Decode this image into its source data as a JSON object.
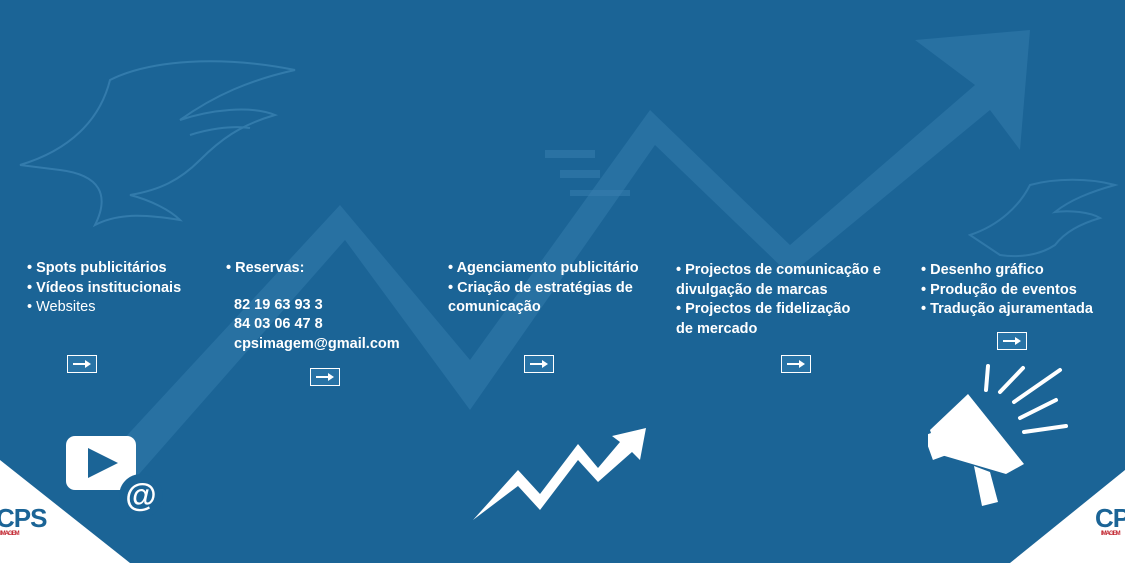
{
  "columns": [
    {
      "items": [
        "• Spots publicitários",
        "• Vídeos institucionais",
        "• Websites"
      ]
    },
    {
      "heading": "• Reservas:",
      "phone1": "82 19 63 93 3",
      "phone2": "84 03 06 47 8",
      "email": "cpsimagem@gmail.com"
    },
    {
      "items": [
        "• Agenciamento publicitário",
        "• Criação de estratégias de",
        "comunicação"
      ]
    },
    {
      "items": [
        "• Projectos de comunicação e",
        "divulgação de marcas",
        "• Projectos de fidelização",
        "de mercado"
      ]
    },
    {
      "items": [
        "• Desenho gráfico",
        "• Produção de eventos",
        "• Tradução ajuramentada"
      ]
    }
  ],
  "logo": {
    "text": "CPS",
    "sub": "IMAGEM"
  },
  "icons": [
    "play-video-icon",
    "at-sign-icon",
    "growth-arrow-icon",
    "megaphone-icon",
    "arrow-right-icon",
    "bird-watermark-icon"
  ],
  "colors": {
    "background": "#1b6496",
    "foreground": "#ffffff",
    "watermark": "#2f7aab",
    "logo_accent": "#c0202a"
  }
}
